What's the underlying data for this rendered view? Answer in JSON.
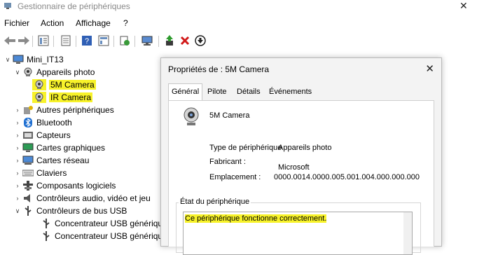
{
  "window": {
    "title": "Gestionnaire de périphériques",
    "app_icon": "device-manager-icon"
  },
  "menu": [
    "Fichier",
    "Action",
    "Affichage",
    "?"
  ],
  "toolbar_icons": [
    "back-arrow-icon",
    "forward-arrow-icon",
    "properties-view-icon",
    "help-list-icon",
    "help-icon",
    "computer-list-icon",
    "scan-hardware-icon",
    "monitor-icon",
    "update-driver-icon",
    "uninstall-x-icon",
    "download-circle-icon"
  ],
  "tree": {
    "root": "Mini_IT13",
    "cameras": "Appareils photo",
    "cam1": "5M Camera",
    "cam2": "IR Camera",
    "other": "Autres périphériques",
    "bluetooth": "Bluetooth",
    "sensors": "Capteurs",
    "graphics": "Cartes graphiques",
    "network": "Cartes réseau",
    "keyboards": "Claviers",
    "software": "Composants logiciels",
    "audio": "Contrôleurs audio, vidéo et jeu",
    "usb": "Contrôleurs de bus USB",
    "usbhub1": "Concentrateur USB générique",
    "usbhub2": "Concentrateur USB générique"
  },
  "dialog": {
    "title": "Propriétés de : 5M Camera",
    "tabs": [
      "Général",
      "Pilote",
      "Détails",
      "Événements"
    ],
    "device_name": "5M Camera",
    "type_label": "Type de périphérique",
    "type_value": "Appareils photo",
    "maker_label": "Fabricant :",
    "maker_value": "Microsoft",
    "location_label": "Emplacement :",
    "location_value": "0000.0014.0000.005.001.004.000.000.000",
    "status_group": "État du périphérique",
    "status_text": "Ce périphérique fonctionne correctement."
  },
  "colors": {
    "highlight": "#f7f22a",
    "dialog_bg": "#f3f3f3",
    "red_x": "#d11a1a"
  }
}
